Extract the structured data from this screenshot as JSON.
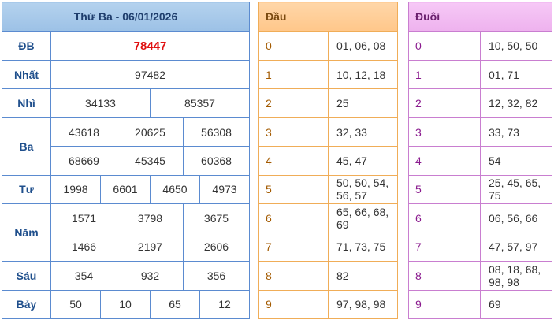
{
  "results": {
    "title": "Thứ Ba - 06/01/2026",
    "rows": {
      "db": {
        "label": "ĐB",
        "values": [
          "78447"
        ]
      },
      "nhat": {
        "label": "Nhất",
        "values": [
          "97482"
        ]
      },
      "nhi": {
        "label": "Nhì",
        "values": [
          "34133",
          "85357"
        ]
      },
      "ba": {
        "label": "Ba",
        "values": [
          "43618",
          "20625",
          "56308",
          "68669",
          "45345",
          "60368"
        ]
      },
      "tu": {
        "label": "Tư",
        "values": [
          "1998",
          "6601",
          "4650",
          "4973"
        ]
      },
      "nam": {
        "label": "Năm",
        "values": [
          "1571",
          "3798",
          "3675",
          "1466",
          "2197",
          "2606"
        ]
      },
      "sau": {
        "label": "Sáu",
        "values": [
          "354",
          "932",
          "356"
        ]
      },
      "bay": {
        "label": "Bảy",
        "values": [
          "50",
          "10",
          "65",
          "12"
        ]
      }
    }
  },
  "dau": {
    "title": "Đầu",
    "rows": [
      {
        "key": "0",
        "value": "01, 06, 08"
      },
      {
        "key": "1",
        "value": "10, 12, 18"
      },
      {
        "key": "2",
        "value": "25"
      },
      {
        "key": "3",
        "value": "32, 33"
      },
      {
        "key": "4",
        "value": "45, 47"
      },
      {
        "key": "5",
        "value": "50, 50, 54, 56, 57"
      },
      {
        "key": "6",
        "value": "65, 66, 68, 69"
      },
      {
        "key": "7",
        "value": "71, 73, 75"
      },
      {
        "key": "8",
        "value": "82"
      },
      {
        "key": "9",
        "value": "97, 98, 98"
      }
    ]
  },
  "duoi": {
    "title": "Đuôi",
    "rows": [
      {
        "key": "0",
        "value": "10, 50, 50"
      },
      {
        "key": "1",
        "value": "01, 71"
      },
      {
        "key": "2",
        "value": "12, 32, 82"
      },
      {
        "key": "3",
        "value": "33, 73"
      },
      {
        "key": "4",
        "value": "54"
      },
      {
        "key": "5",
        "value": "25, 45, 65, 75"
      },
      {
        "key": "6",
        "value": "06, 56, 66"
      },
      {
        "key": "7",
        "value": "47, 57, 97"
      },
      {
        "key": "8",
        "value": "08, 18, 68, 98, 98"
      },
      {
        "key": "9",
        "value": "69"
      }
    ]
  },
  "colors": {
    "results_border": "#5b8bd0",
    "dau_border": "#f0ad58",
    "duoi_border": "#c97ed0",
    "special_prize": "#e01010"
  }
}
